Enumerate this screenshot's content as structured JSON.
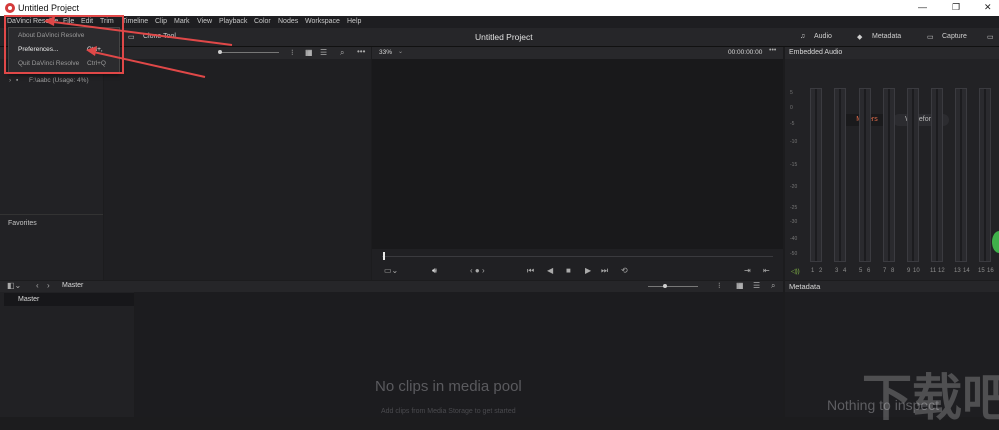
{
  "window": {
    "title": "Untitled Project",
    "min": "—",
    "max": "❐",
    "close": "✕"
  },
  "menubar": [
    "DaVinci Resolve",
    "File",
    "Edit",
    "Trim",
    "Timeline",
    "Clip",
    "Mark",
    "View",
    "Playback",
    "Color",
    "Nodes",
    "Workspace",
    "Help"
  ],
  "app_menu": {
    "items": [
      {
        "label": "About DaVinci Resolve",
        "shortcut": ""
      },
      {
        "label": "Preferences...",
        "shortcut": "Ctrl+,"
      },
      {
        "label": "Quit DaVinci Resolve",
        "shortcut": "Ctrl+Q"
      }
    ]
  },
  "toolbar": {
    "clone_tool": "Clone Tool",
    "project_title": "Untitled Project",
    "audio": "Audio",
    "metadata": "Metadata",
    "capture": "Capture"
  },
  "viewer": {
    "zoom": "33%",
    "timecode": "00:00:00:00"
  },
  "storage": {
    "drive": "F:\\aabc (Usage: 4%)",
    "favorites": "Favorites"
  },
  "audio_panel": {
    "title": "Embedded Audio",
    "tabs": [
      "Meters",
      "Waveform"
    ],
    "active_tab": "Meters",
    "db_scale": [
      "5",
      "0",
      "-5",
      "-10",
      "-15",
      "-20",
      "-25",
      "-30",
      "-40",
      "-50"
    ],
    "channels": [
      "1",
      "2",
      "3",
      "4",
      "5",
      "6",
      "7",
      "8",
      "9",
      "10",
      "11",
      "12",
      "13",
      "14",
      "15",
      "16"
    ]
  },
  "media_pool": {
    "bin_header": "Master",
    "bin_item": "Master",
    "empty_title": "No clips in media pool",
    "empty_subtitle": "Add clips from Media Storage to get started"
  },
  "metadata_panel": {
    "title": "Metadata",
    "empty_text": "Nothing to inspect"
  },
  "watermark": {
    "text": "下载吧"
  },
  "colors": {
    "accent_red": "#e04848",
    "active_tab_text": "#e06b4a",
    "background": "#1c1c1e"
  }
}
